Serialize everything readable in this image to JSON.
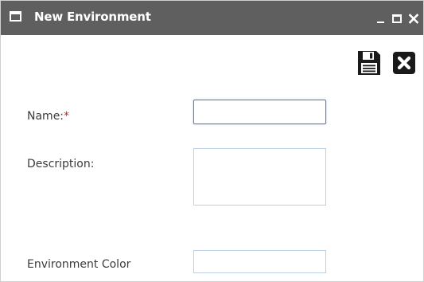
{
  "window": {
    "title": "New Environment",
    "controls": {
      "minimize_icon": "minimize-icon",
      "maximize_icon": "maximize-icon",
      "close_icon": "close-icon"
    }
  },
  "toolbar": {
    "save_icon": "save-floppy-icon",
    "cancel_icon": "close-x-icon"
  },
  "form": {
    "name": {
      "label": "Name:",
      "required_marker": "*",
      "value": ""
    },
    "description": {
      "label": "Description:",
      "value": ""
    },
    "environment_color": {
      "label": "Environment Color",
      "value": ""
    }
  },
  "colors": {
    "titlebar": "#5f5f5f",
    "required": "#d22525",
    "focus_border": "#4d84c9",
    "field_border": "#bcd0e6"
  }
}
